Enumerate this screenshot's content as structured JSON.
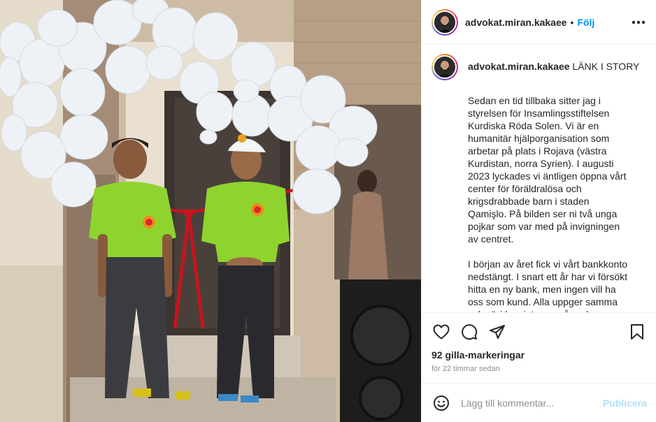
{
  "post": {
    "username": "advokat.miran.kakaee",
    "separator": "•",
    "follow_label": "Följ",
    "more_icon": "more-horizontal-icon",
    "caption_user": "advokat.miran.kakaee",
    "caption_headline": "LÄNK I STORY",
    "caption_body": "Sedan en tid tillbaka sitter jag i styrelsen för Insamlingsstiftelsen Kurdiska Röda Solen. Vi är en humanitär hjälporganisation som arbetar på plats i Rojava (västra Kurdistan, norra Syrien). I augusti 2023 lyckades vi äntligen öppna vårt center för föräldralösa och krigsdrabbade barn i staden Qamişlo. På bilden ser ni två unga pojkar som var med på invigningen av centret.\n\nI början av året fick vi vårt bankkonto nedstängt. I snart ett år har vi försökt hitta en ny bank, men ingen vill ha oss som kund. Alla uppger samma sak - \"vi kan inte uppnå god kundkännedom\". Det är en konsekvens av den negativa inställning",
    "likes": "92 gilla-markeringar",
    "time": "för 22 timmar sedan"
  },
  "actions": {
    "like_icon": "heart-icon",
    "comment_icon": "comment-icon",
    "share_icon": "share-icon",
    "save_icon": "bookmark-icon"
  },
  "comment": {
    "emoji_icon": "emoji-icon",
    "placeholder": "Lägg till kommentar...",
    "post_label": "Publicera"
  },
  "colors": {
    "accent": "#0095f6",
    "post_disabled": "#b2dffc",
    "shirt_green": "#8fd42e",
    "ribbon_red": "#c8141e"
  }
}
